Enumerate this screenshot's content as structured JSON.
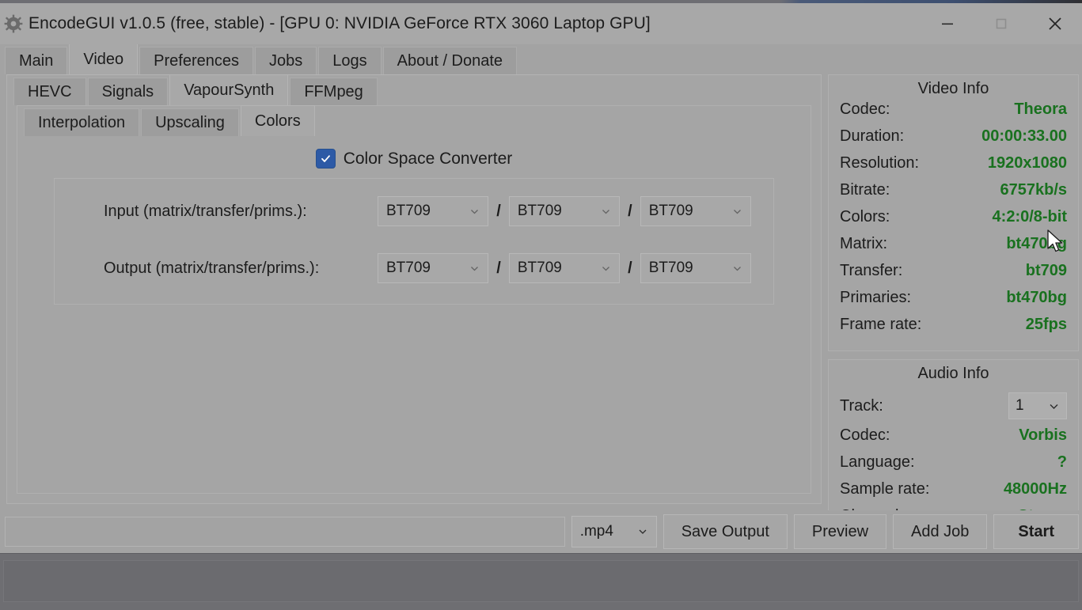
{
  "window": {
    "title": "EncodeGUI v1.0.5 (free, stable) - [GPU 0: NVIDIA GeForce RTX 3060 Laptop GPU]",
    "app_icon": "gear-icon",
    "controls": {
      "minimize": "—",
      "maximize": "☐",
      "close": "✕"
    }
  },
  "main_tabs": [
    {
      "label": "Main",
      "selected": false
    },
    {
      "label": "Video",
      "selected": true
    },
    {
      "label": "Preferences",
      "selected": false
    },
    {
      "label": "Jobs",
      "selected": false
    },
    {
      "label": "Logs",
      "selected": false
    },
    {
      "label": "About / Donate",
      "selected": false
    }
  ],
  "sub_tabs": [
    {
      "label": "HEVC",
      "selected": false
    },
    {
      "label": "Signals",
      "selected": false
    },
    {
      "label": "VapourSynth",
      "selected": true
    },
    {
      "label": "FFMpeg",
      "selected": false
    }
  ],
  "sub_sub_tabs": [
    {
      "label": "Interpolation",
      "selected": false
    },
    {
      "label": "Upscaling",
      "selected": false
    },
    {
      "label": "Colors",
      "selected": true
    }
  ],
  "colors_panel": {
    "converter_checkbox": {
      "label": "Color Space Converter",
      "checked": true
    },
    "rows": [
      {
        "label": "Input (matrix/transfer/prims.):",
        "matrix": "BT709",
        "transfer": "BT709",
        "primaries": "BT709"
      },
      {
        "label": "Output (matrix/transfer/prims.):",
        "matrix": "BT709",
        "transfer": "BT709",
        "primaries": "BT709"
      }
    ],
    "separator": "/"
  },
  "video_info": {
    "title": "Video Info",
    "rows": [
      {
        "key": "Codec:",
        "value": "Theora"
      },
      {
        "key": "Duration:",
        "value": "00:00:33.00"
      },
      {
        "key": "Resolution:",
        "value": "1920x1080"
      },
      {
        "key": "Bitrate:",
        "value": "6757kb/s"
      },
      {
        "key": "Colors:",
        "value": "4:2:0/8-bit"
      },
      {
        "key": "Matrix:",
        "value": "bt470bg"
      },
      {
        "key": "Transfer:",
        "value": "bt709"
      },
      {
        "key": "Primaries:",
        "value": "bt470bg"
      },
      {
        "key": "Frame rate:",
        "value": "25fps"
      }
    ]
  },
  "audio_info": {
    "title": "Audio Info",
    "track_label": "Track:",
    "track_value": "1",
    "rows": [
      {
        "key": "Codec:",
        "value": "Vorbis"
      },
      {
        "key": "Language:",
        "value": "?"
      },
      {
        "key": "Sample rate:",
        "value": "48000Hz"
      },
      {
        "key": "Channels:",
        "value": "Stereo"
      }
    ]
  },
  "bottom_bar": {
    "path_value": "",
    "path_placeholder": "",
    "format_value": ".mp4",
    "save_output_label": "Save Output",
    "preview_label": "Preview",
    "add_job_label": "Add Job",
    "start_label": "Start"
  },
  "colors": {
    "value_green": "#19711f",
    "checkbox_blue": "#2d5aa6",
    "window_bg": "#a3a3a3",
    "statusbar_bg": "#6e6e72"
  }
}
